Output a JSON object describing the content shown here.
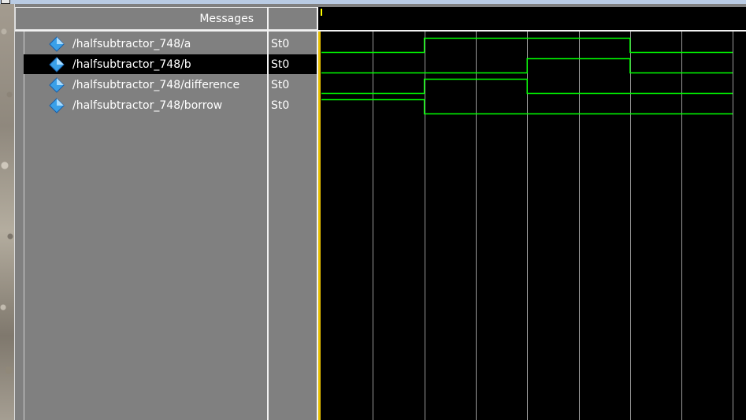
{
  "header": {
    "messages_label": "Messages"
  },
  "signals": [
    {
      "name": "/halfsubtractor_748/a",
      "value": "St0",
      "selected": false,
      "waveform": [
        0,
        0,
        1,
        1,
        1,
        1,
        0,
        0
      ]
    },
    {
      "name": "/halfsubtractor_748/b",
      "value": "St0",
      "selected": true,
      "waveform": [
        0,
        0,
        0,
        0,
        1,
        1,
        0,
        0
      ]
    },
    {
      "name": "/halfsubtractor_748/difference",
      "value": "St0",
      "selected": false,
      "waveform": [
        0,
        0,
        1,
        1,
        0,
        0,
        0,
        0
      ]
    },
    {
      "name": "/halfsubtractor_748/borrow",
      "value": "St0",
      "selected": false,
      "waveform": [
        1,
        1,
        0,
        0,
        0,
        0,
        0,
        0
      ]
    }
  ],
  "icons": {
    "signal": "blue-diamond-icon"
  },
  "colors": {
    "wave_bg": "#000000",
    "wave_line": "#00ff00",
    "grid": "#9a9a9a",
    "pane_bg": "#808080",
    "cursor": "#ffff00",
    "icon_blue": "#3aa0e8"
  }
}
